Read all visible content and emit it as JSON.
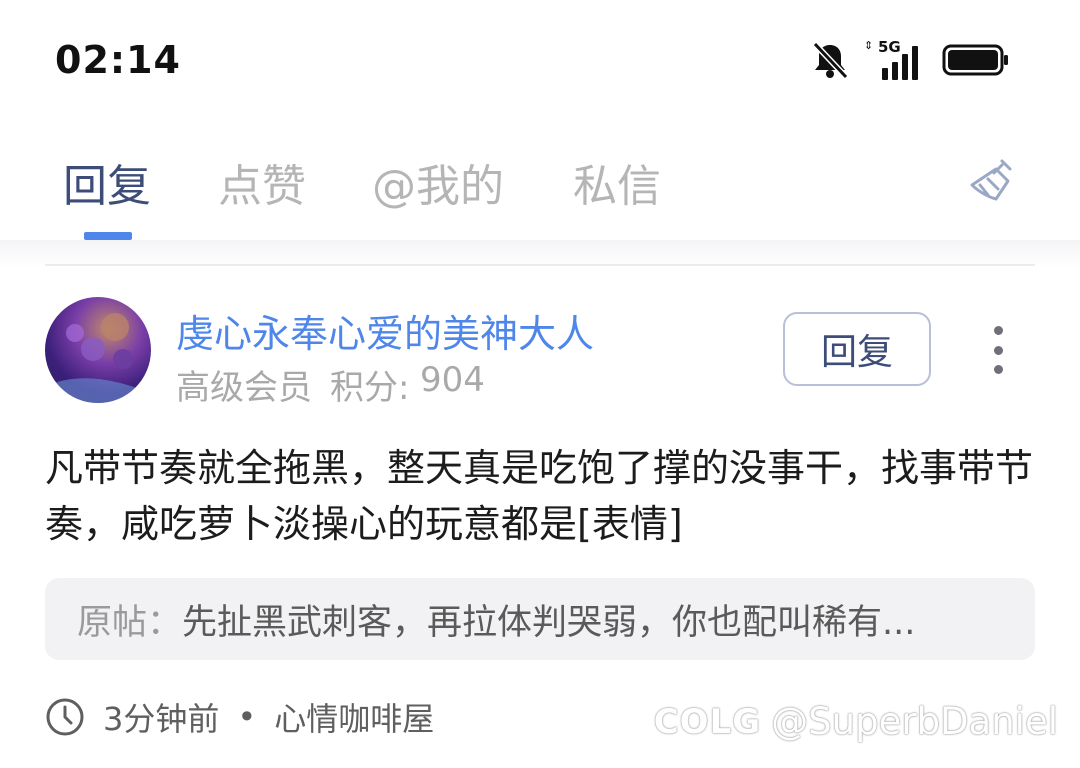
{
  "status_bar": {
    "time": "02:14",
    "network": "5G",
    "icons": [
      "bell-muted-icon",
      "signal-5g-icon",
      "battery-icon"
    ]
  },
  "tabs": [
    {
      "label": "回复",
      "active": true
    },
    {
      "label": "点赞",
      "active": false
    },
    {
      "label": "@我的",
      "active": false
    },
    {
      "label": "私信",
      "active": false
    }
  ],
  "toolbar": {
    "clear_icon": "broom-icon"
  },
  "notification": {
    "username": "虔心永奉心爱的美神大人",
    "rank": "高级会员",
    "score_label": "积分:",
    "score": "904",
    "reply_button": "回复",
    "content": "凡带节奏就全拖黑，整天真是吃饱了撑的没事干，找事带节奏，咸吃萝卜淡操心的玩意都是[表情]",
    "quote_label": "原帖：",
    "quote_text": "先扯黑武刺客，再拉体判哭弱，你也配叫稀有...",
    "time": "3分钟前",
    "separator": "•",
    "forum": "心情咖啡屋"
  },
  "watermark": {
    "logo": "COLG",
    "handle": "@SuperbDaniel"
  },
  "colors": {
    "accent": "#4f86ea",
    "active_tab": "#3d4d78",
    "inactive_tab": "#b5b5b5"
  }
}
